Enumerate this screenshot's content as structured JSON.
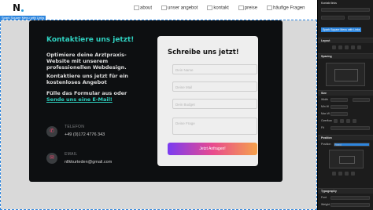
{
  "nav": {
    "links": [
      "about",
      "unser angebot",
      "kontakt",
      "preise",
      "häufige Fragen"
    ]
  },
  "selection": {
    "label": "Spark Square Menu with Links"
  },
  "contact": {
    "title": "Kontaktiere uns jetzt!",
    "text1": "Optimiere deine Arztpraxis-Website mit unserem professionellen Webdesign.",
    "text2": "Kontaktiere uns jetzt für ein kostenloses Angebot",
    "text3_prefix": "Fülle das Formular aus oder",
    "text3_link": "Sende uns eine E-Mail!",
    "phone_label": "TELEFON",
    "phone_value": "+49 (0)172 4776 343",
    "email_label": "EMAIL",
    "email_value": "nllkkurteden@gmail.com"
  },
  "form": {
    "title": "Schreibe uns jetzt!",
    "placeholders": [
      "Dein Name",
      "Deine Mail",
      "Dein Budget",
      "Deine Frage"
    ],
    "button": "Jetzt Anfragen!"
  },
  "panel": {
    "title": "Kontakt links",
    "tag": "Spark Square Menu with Links",
    "sections": [
      "Layout",
      "Spacing",
      "Size",
      "Position",
      "Typography"
    ],
    "size_rows": [
      "Width",
      "Min W",
      "Max W",
      "Overflow",
      "Fit"
    ],
    "position_label": "Position",
    "typo_rows": [
      "Font",
      "Weight"
    ],
    "fixed_label": "Fixed"
  },
  "colors": {
    "accent": "#2fd1c0",
    "selection": "#2e86de",
    "button_start": "#7a3cf2",
    "button_end": "#f5a24b"
  }
}
